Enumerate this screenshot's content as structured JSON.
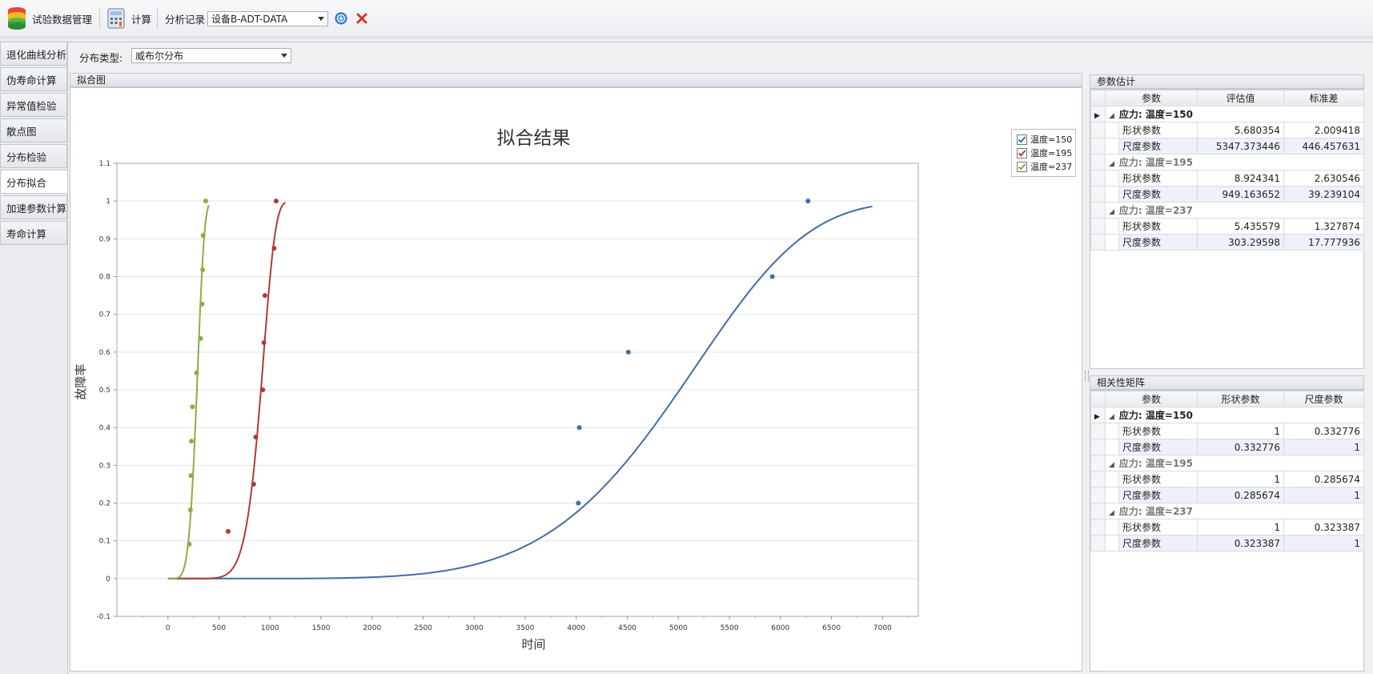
{
  "toolbar": {
    "app_title": "试验数据管理",
    "calc_label": "计算",
    "record_label": "分析记录",
    "record_value": "设备B-ADT-DATA"
  },
  "left_tabs": [
    "退化曲线分析",
    "伪寿命计算",
    "异常值检验",
    "散点图",
    "分布检验",
    "分布拟合",
    "加速参数计算",
    "寿命计算"
  ],
  "active_tab": 5,
  "dist": {
    "label": "分布类型:",
    "value": "威布尔分布"
  },
  "fit_panel": {
    "title": "拟合图"
  },
  "chart_data": {
    "type": "scatter",
    "title": "拟合结果",
    "xlabel": "时间",
    "ylabel": "故障率",
    "xlim": [
      -500,
      7350
    ],
    "ylim": [
      -0.1,
      1.1
    ],
    "x_ticks": [
      "0",
      "500",
      "1000",
      "1500",
      "2000",
      "2500",
      "3000",
      "3500",
      "4000",
      "4500",
      "5000",
      "5500",
      "6000",
      "6500",
      "7000"
    ],
    "y_ticks": [
      "-0.1",
      "0",
      "0.1",
      "0.2",
      "0.3",
      "0.4",
      "0.5",
      "0.6",
      "0.7",
      "0.8",
      "0.9",
      "1",
      "1.1"
    ],
    "grid": true,
    "legend_position": "top-right",
    "series": [
      {
        "name": "温度=150",
        "color": "#3f6ea8",
        "shape": 5.680354,
        "scale": 5347.373446,
        "curve_x_max": 6900,
        "points": [
          [
            4020,
            0.2
          ],
          [
            4030,
            0.4
          ],
          [
            4510,
            0.6
          ],
          [
            5920,
            0.8
          ],
          [
            6270,
            1.0
          ]
        ]
      },
      {
        "name": "温度=195",
        "color": "#b23a36",
        "shape": 8.924341,
        "scale": 949.163652,
        "curve_x_max": 1150,
        "points": [
          [
            590,
            0.125
          ],
          [
            840,
            0.25
          ],
          [
            860,
            0.375
          ],
          [
            930,
            0.5
          ],
          [
            940,
            0.625
          ],
          [
            950,
            0.75
          ],
          [
            1040,
            0.875
          ],
          [
            1060,
            1.0
          ]
        ]
      },
      {
        "name": "温度=237",
        "color": "#8aae45",
        "shape": 5.435579,
        "scale": 303.29598,
        "curve_x_max": 400,
        "points": [
          [
            210,
            0.091
          ],
          [
            220,
            0.182
          ],
          [
            225,
            0.273
          ],
          [
            230,
            0.364
          ],
          [
            240,
            0.455
          ],
          [
            280,
            0.545
          ],
          [
            320,
            0.636
          ],
          [
            335,
            0.727
          ],
          [
            340,
            0.818
          ],
          [
            345,
            0.909
          ],
          [
            370,
            1.0
          ]
        ]
      }
    ]
  },
  "params": {
    "title": "参数估计",
    "columns": [
      "参数",
      "评估值",
      "标准差"
    ],
    "groups": [
      {
        "label": "应力: 温度=150",
        "rows": [
          [
            "形状参数",
            "5.680354",
            "2.009418"
          ],
          [
            "尺度参数",
            "5347.373446",
            "446.457631"
          ]
        ]
      },
      {
        "label": "应力: 温度=195",
        "rows": [
          [
            "形状参数",
            "8.924341",
            "2.630546"
          ],
          [
            "尺度参数",
            "949.163652",
            "39.239104"
          ]
        ]
      },
      {
        "label": "应力: 温度=237",
        "rows": [
          [
            "形状参数",
            "5.435579",
            "1.327874"
          ],
          [
            "尺度参数",
            "303.29598",
            "17.777936"
          ]
        ]
      }
    ]
  },
  "corr": {
    "title": "相关性矩阵",
    "columns": [
      "参数",
      "形状参数",
      "尺度参数"
    ],
    "groups": [
      {
        "label": "应力: 温度=150",
        "rows": [
          [
            "形状参数",
            "1",
            "0.332776"
          ],
          [
            "尺度参数",
            "0.332776",
            "1"
          ]
        ]
      },
      {
        "label": "应力: 温度=195",
        "rows": [
          [
            "形状参数",
            "1",
            "0.285674"
          ],
          [
            "尺度参数",
            "0.285674",
            "1"
          ]
        ]
      },
      {
        "label": "应力: 温度=237",
        "rows": [
          [
            "形状参数",
            "1",
            "0.323387"
          ],
          [
            "尺度参数",
            "0.323387",
            "1"
          ]
        ]
      }
    ]
  }
}
